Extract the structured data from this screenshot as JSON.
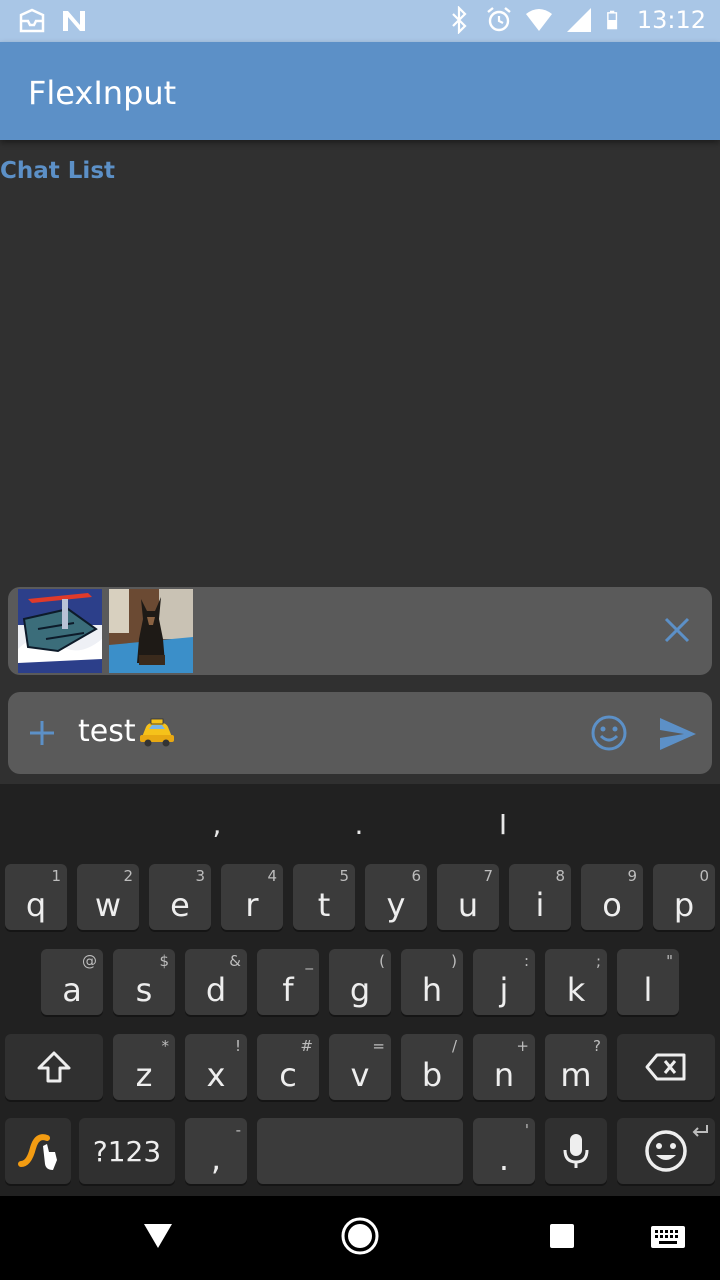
{
  "status_bar": {
    "time": "13:12",
    "left_icons": [
      "inbox-icon",
      "n-app-icon"
    ],
    "right_icons": [
      "bluetooth-icon",
      "alarm-icon",
      "wifi-icon",
      "signal-icon",
      "battery-icon"
    ]
  },
  "app_bar": {
    "title": "FlexInput",
    "color": "#5c90c7"
  },
  "chat_list": {
    "label": "Chat List"
  },
  "attachments": {
    "items": [
      "comic-thumbnail",
      "dog-photo-thumbnail"
    ],
    "close_icon": "close-icon"
  },
  "input": {
    "text": "test",
    "emoji": "taxi-emoji",
    "add_icon": "plus-icon",
    "emoji_button_icon": "smiley-icon",
    "send_icon": "send-icon",
    "accent": "#5c90c7"
  },
  "keyboard": {
    "suggestions": [
      ",",
      ".",
      "I"
    ],
    "row1": [
      {
        "key": "q",
        "hint": "1"
      },
      {
        "key": "w",
        "hint": "2"
      },
      {
        "key": "e",
        "hint": "3"
      },
      {
        "key": "r",
        "hint": "4"
      },
      {
        "key": "t",
        "hint": "5"
      },
      {
        "key": "y",
        "hint": "6"
      },
      {
        "key": "u",
        "hint": "7"
      },
      {
        "key": "i",
        "hint": "8"
      },
      {
        "key": "o",
        "hint": "9"
      },
      {
        "key": "p",
        "hint": "0"
      }
    ],
    "row2": [
      {
        "key": "a",
        "hint": "@"
      },
      {
        "key": "s",
        "hint": "$"
      },
      {
        "key": "d",
        "hint": "&"
      },
      {
        "key": "f",
        "hint": "_"
      },
      {
        "key": "g",
        "hint": "("
      },
      {
        "key": "h",
        "hint": ")"
      },
      {
        "key": "j",
        "hint": ":"
      },
      {
        "key": "k",
        "hint": ";"
      },
      {
        "key": "l",
        "hint": "\""
      }
    ],
    "row3": [
      {
        "key": "z",
        "hint": "*"
      },
      {
        "key": "x",
        "hint": "!"
      },
      {
        "key": "c",
        "hint": "#"
      },
      {
        "key": "v",
        "hint": "="
      },
      {
        "key": "b",
        "hint": "/"
      },
      {
        "key": "n",
        "hint": "+"
      },
      {
        "key": "m",
        "hint": "?"
      }
    ],
    "symbols_label": "?123",
    "comma": ",",
    "comma_hint": "-",
    "period": ".",
    "period_hint": "'"
  },
  "nav_bar": {
    "icons": [
      "back-icon",
      "home-icon",
      "recents-icon",
      "keyboard-switch-icon"
    ]
  }
}
